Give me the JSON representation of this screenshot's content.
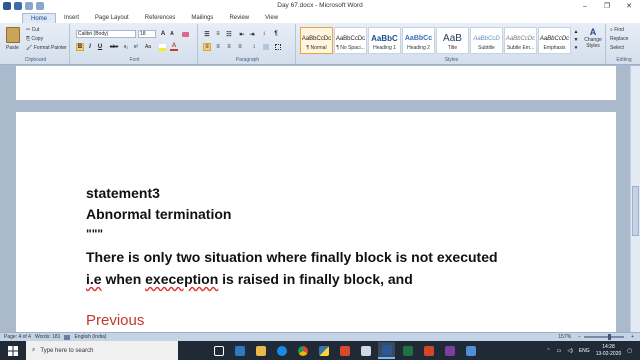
{
  "window": {
    "title": "Day 67.docx - Microsoft Word",
    "minimize_glyph": "–",
    "restore_glyph": "❐",
    "close_glyph": "✕"
  },
  "tabs": [
    "Home",
    "Insert",
    "Page Layout",
    "References",
    "Mailings",
    "Review",
    "View"
  ],
  "ribbon": {
    "clipboard": {
      "paste_label": "Paste",
      "cut_label": "Cut",
      "copy_label": "Copy",
      "format_painter_label": "Format Painter",
      "group_label": "Clipboard"
    },
    "font": {
      "font_name": "Calibri (Body)",
      "font_size": "18",
      "group_label": "Font",
      "bold": "B",
      "italic": "I",
      "underline": "U",
      "strike": "abe",
      "subscript": "x₂",
      "superscript": "x²",
      "case": "Aa",
      "grow": "A",
      "shrink": "A",
      "text_color": "A"
    },
    "paragraph": {
      "group_label": "Paragraph"
    },
    "styles": {
      "group_label": "Styles",
      "items": [
        {
          "sample": "AaBbCcDc",
          "name": "¶ Normal"
        },
        {
          "sample": "AaBbCcDc",
          "name": "¶ No Spaci..."
        },
        {
          "sample": "AaBbC",
          "name": "Heading 1"
        },
        {
          "sample": "AaBbCc",
          "name": "Heading 2"
        },
        {
          "sample": "AaB",
          "name": "Title"
        },
        {
          "sample": "AaBbCcD",
          "name": "Subtitle"
        },
        {
          "sample": "AaBbCcDc",
          "name": "Subtle Em..."
        },
        {
          "sample": "AaBbCcDc",
          "name": "Emphasis"
        }
      ],
      "change_styles_label": "Change Styles"
    },
    "editing": {
      "group_label": "Editing",
      "find_label": "Find",
      "replace_label": "Replace",
      "select_label": "Select"
    }
  },
  "document": {
    "lines": [
      "statement3",
      "Abnormal termination",
      "\"\"\"",
      "There is only two situation where finally block is not executed",
      "i.e when exeception is raised in finally block, and"
    ],
    "line4_parts": {
      "a": "i.e",
      "b": " when ",
      "c": "exeception",
      "d": " is raised in finally block, and"
    },
    "heading": "Previous",
    "heading_color": "#c0392b"
  },
  "status": {
    "page": "Page: 4 of 4",
    "words": "Words: 181",
    "language": "English (India)",
    "zoom": "157%"
  },
  "taskbar": {
    "search_placeholder": "Type here to search",
    "tray_language": "ENG",
    "time": "14:28",
    "date": "13-02-2020"
  }
}
